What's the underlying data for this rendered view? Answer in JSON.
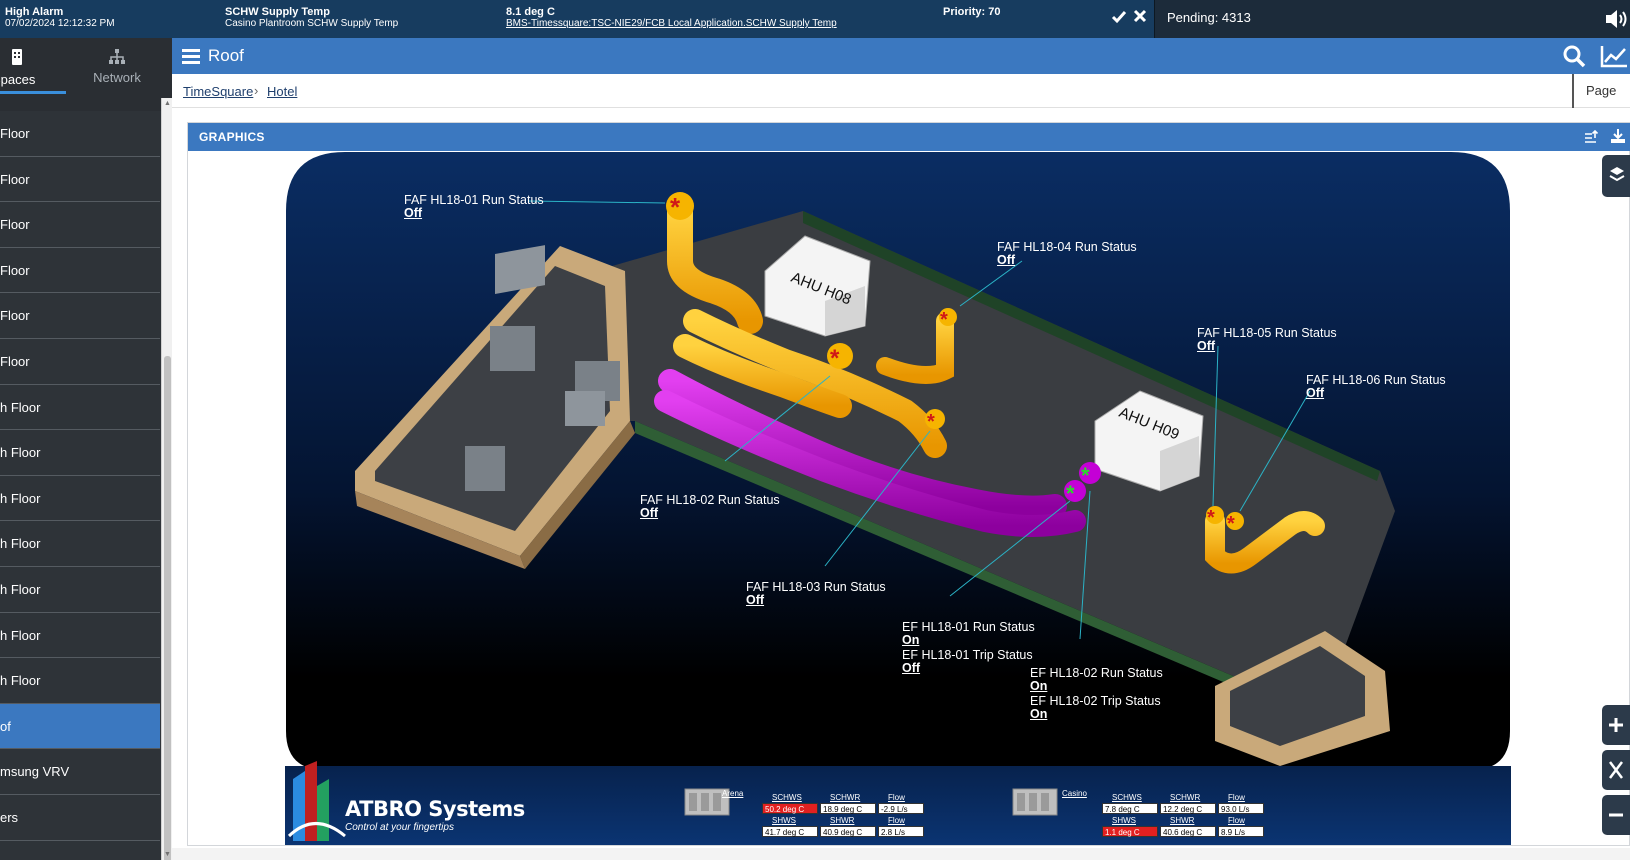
{
  "alarm": {
    "severity": "High Alarm",
    "datetime": "07/02/2024 12:12:32 PM",
    "point_name": "SCHW Supply Temp",
    "point_desc": "Casino Plantroom SCHW Supply Temp",
    "value": "8.1 deg C",
    "path": "BMS-Timessquare:TSC-NIE29/FCB Local Application.SCHW Supply Temp",
    "priority": "Priority: 70",
    "pending": "Pending: 4313"
  },
  "sidebar": {
    "tabs": [
      {
        "label": "Spaces",
        "icon": "building-icon"
      },
      {
        "label": "Network",
        "icon": "network-icon"
      }
    ],
    "items": [
      {
        "label": "Floor"
      },
      {
        "label": "Floor"
      },
      {
        "label": "Floor"
      },
      {
        "label": "Floor"
      },
      {
        "label": "Floor"
      },
      {
        "label": "Floor"
      },
      {
        "label": "h Floor"
      },
      {
        "label": "h Floor"
      },
      {
        "label": "h Floor"
      },
      {
        "label": "h Floor"
      },
      {
        "label": "h Floor"
      },
      {
        "label": "h Floor"
      },
      {
        "label": "h Floor"
      },
      {
        "label": "of"
      },
      {
        "label": "msung VRV"
      },
      {
        "label": "ers"
      }
    ],
    "active_index": 13
  },
  "header": {
    "title": "Roof"
  },
  "breadcrumb": {
    "items": [
      "TimeSquare",
      "Hotel"
    ],
    "separator": "›",
    "page_label": "Page"
  },
  "panel": {
    "title": "GRAPHICS"
  },
  "graphic": {
    "ahu_labels": [
      "AHU H08",
      "AHU H09"
    ],
    "points": [
      {
        "label": "FAF HL18-01 Run Status",
        "value": "Off"
      },
      {
        "label": "FAF HL18-04 Run Status",
        "value": "Off"
      },
      {
        "label": "FAF HL18-05 Run Status",
        "value": "Off"
      },
      {
        "label": "FAF HL18-06 Run Status",
        "value": "Off"
      },
      {
        "label": "FAF HL18-02 Run Status",
        "value": "Off"
      },
      {
        "label": "FAF HL18-03 Run Status",
        "value": "Off"
      },
      {
        "label": "EF HL18-01 Run Status",
        "value": "On"
      },
      {
        "label": "EF HL18-01 Trip Status",
        "value": "Off"
      },
      {
        "label": "EF HL18-02 Run Status",
        "value": "On"
      },
      {
        "label": "EF HL18-02 Trip Status",
        "value": "On"
      }
    ],
    "brand": {
      "name": "ATBRO Systems",
      "tagline": "Control at your fingertips"
    },
    "plants": [
      {
        "name": "Arena",
        "headers1": [
          "SCHWS",
          "SCHWR",
          "Flow"
        ],
        "values1": [
          "50.2 deg C",
          "18.9 deg C",
          "-2.9 L/s"
        ],
        "headers2": [
          "SHWS",
          "SHWR",
          "Flow"
        ],
        "values2": [
          "41.7 deg C",
          "40.9 deg C",
          "2.8 L/s"
        ],
        "alarm_cells": [
          "v1_0"
        ]
      },
      {
        "name": "Casino",
        "headers1": [
          "SCHWS",
          "SCHWR",
          "Flow"
        ],
        "values1": [
          "7.8 deg C",
          "12.2 deg C",
          "93.0 L/s"
        ],
        "headers2": [
          "SHWS",
          "SHWR",
          "Flow"
        ],
        "values2": [
          "1.1 deg C",
          "40.6 deg C",
          "8.9 L/s"
        ],
        "alarm_cells": [
          "v2_0"
        ]
      }
    ]
  },
  "colors": {
    "header_blue": "#3b78c0",
    "alarm_bar": "#173c5f",
    "sidebar": "#2e3338",
    "alarm_red": "#e22020",
    "supply_duct": "#f7b500",
    "exhaust_duct": "#c400d6"
  }
}
